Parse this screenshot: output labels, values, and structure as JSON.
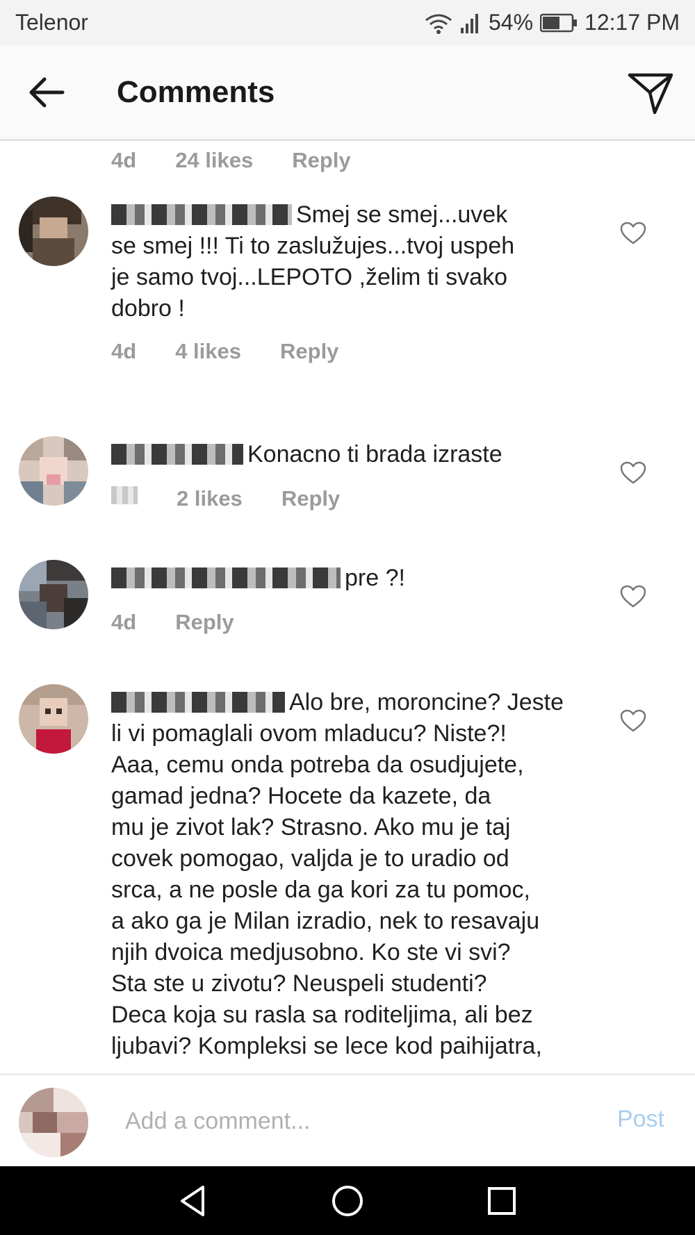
{
  "status_bar": {
    "carrier": "Telenor",
    "battery": "54%",
    "time": "12:17 PM"
  },
  "header": {
    "title": "Comments"
  },
  "top_meta": {
    "age": "4d",
    "likes": "24 likes",
    "reply": "Reply"
  },
  "comments": [
    {
      "lines": [
        "Smej se smej...uvek",
        "se smej !!! Ti to zaslužujes...tvoj uspeh",
        "je samo tvoj...LEPOTO ,želim ti svako",
        "dobro !"
      ],
      "age": "4d",
      "likes": "4 likes",
      "reply": "Reply"
    },
    {
      "lines": [
        "Konacno ti brada izraste"
      ],
      "likes": "2 likes",
      "reply": "Reply"
    },
    {
      "lines": [
        "pre ?!"
      ],
      "age": "4d",
      "reply": "Reply"
    },
    {
      "lines": [
        "Alo bre, moroncine? Jeste",
        "li vi pomaglali ovom mladucu? Niste?!",
        "Aaa, cemu onda potreba da osudjujete,",
        "gamad jedna?  Hocete da kazete, da",
        "mu je zivot lak?  Strasno. Ako mu je taj",
        "covek pomogao, valjda je to uradio od",
        "srca, a ne posle da ga kori za tu pomoc,",
        "a ako ga je Milan izradio, nek to resavaju",
        "njih dvoica medjusobno. Ko ste vi svi?",
        "Sta ste u zivotu? Neuspeli studenti?",
        "Deca koja su rasla sa roditeljima, ali bez",
        "ljubavi? Kompleksi se lece kod paihijatra,"
      ]
    }
  ],
  "input": {
    "placeholder": "Add a comment...",
    "post_label": "Post"
  },
  "colors": {
    "meta_gray": "#9b9b9b",
    "post_blue": "#a9cdf0"
  }
}
